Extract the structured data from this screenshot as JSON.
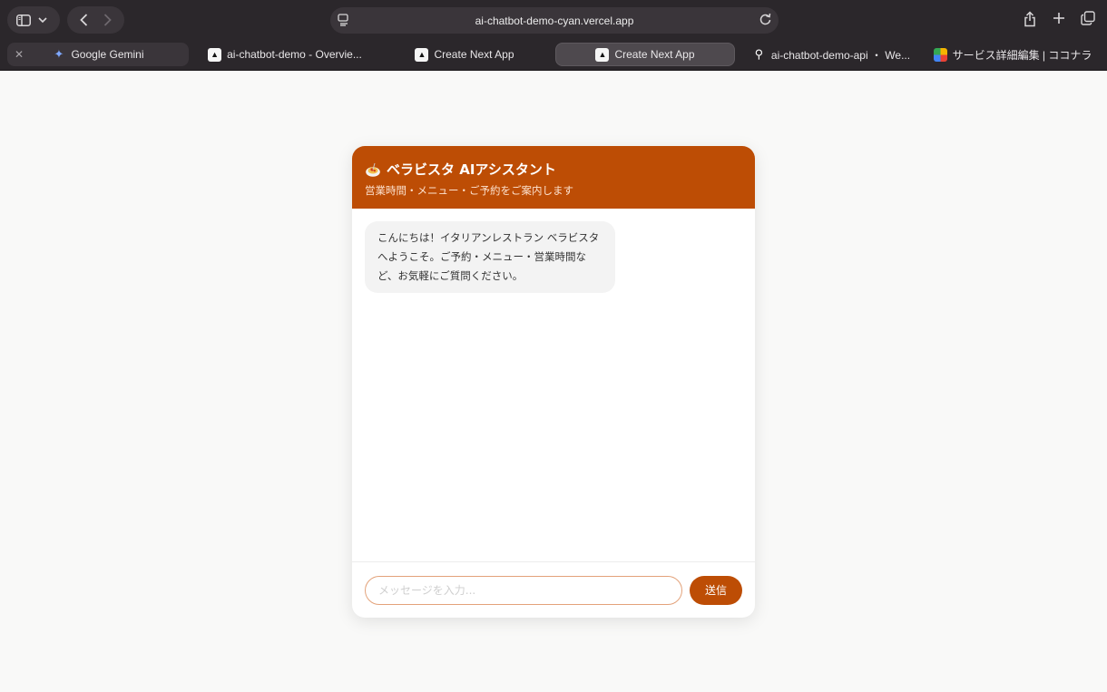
{
  "browser": {
    "url": "ai-chatbot-demo-cyan.vercel.app",
    "tabs": [
      {
        "label": "Google Gemini",
        "icon": "gemini-sparkle-icon"
      },
      {
        "label": "ai-chatbot-demo - Overvie...",
        "icon": "vercel-triangle-icon"
      },
      {
        "label": "Create Next App",
        "icon": "vercel-triangle-icon"
      },
      {
        "label": "Create Next App",
        "icon": "vercel-triangle-icon",
        "active": true
      },
      {
        "label": "ai-chatbot-demo-api ・ We...",
        "icon": "railway-icon"
      },
      {
        "label": "サービス詳細編集 | ココナラ",
        "icon": "coconala-icon"
      }
    ]
  },
  "chat": {
    "title": "ベラビスタ AIアシスタント",
    "subtitle": "営業時間・メニュー・ご予約をご案内します",
    "messages": [
      {
        "role": "assistant",
        "text": "こんにちは！イタリアンレストラン ベラビスタへようこそ。ご予約・メニュー・営業時間など、お気軽にご質問ください。"
      }
    ],
    "input": {
      "value": "",
      "placeholder": "メッセージを入力..."
    },
    "send_label": "送信"
  },
  "colors": {
    "accent": "#bd4d05",
    "chrome": "#2b272b"
  }
}
